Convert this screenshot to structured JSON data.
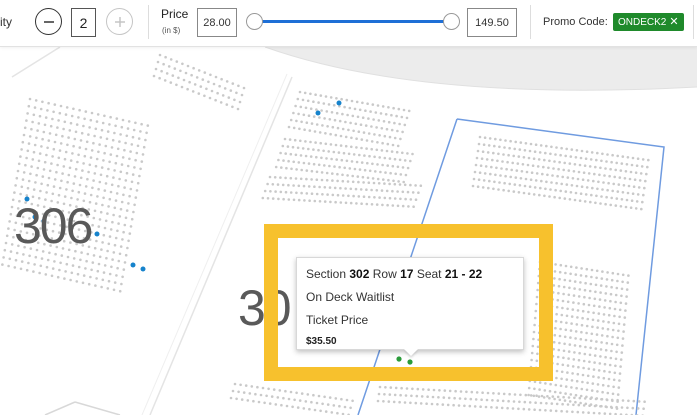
{
  "toolbar": {
    "quantity_label": "ity",
    "quantity_value": "2",
    "price_label": "Price",
    "price_sub": "(in $)",
    "price_min": "28.00",
    "price_max": "149.50",
    "promo_label": "Promo Code:",
    "promo_code": "ONDECK2",
    "promo_remove": "✕",
    "accent_color": "#1e6fd6",
    "promo_color": "#1f8a2b"
  },
  "map": {
    "section_left": "306",
    "section_center": "30"
  },
  "tooltip": {
    "section_label": "Section",
    "section_value": "302",
    "row_label": "Row",
    "row_value": "17",
    "seat_label": "Seat",
    "seat_value": "21 - 22",
    "waitlist": "On Deck Waitlist",
    "ticket_price_label": "Ticket Price",
    "ticket_price": "$35.50",
    "highlight_color": "#f7c12d"
  }
}
